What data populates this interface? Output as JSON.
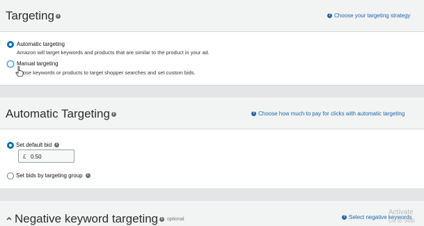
{
  "targeting": {
    "title": "Targeting",
    "strategy_link": "Choose your targeting strategy",
    "automatic_label": "Automatic targeting",
    "automatic_desc": "Amazon will target keywords and products that are similar to the product in your ad.",
    "manual_label": "Manual targeting",
    "manual_desc": "ose keywords or products to target shopper searches and set custom bids."
  },
  "auto_targeting": {
    "title": "Automatic Targeting",
    "pay_link": "Choose how much to pay for clicks with automatic targeting",
    "default_bid_label": "Set default bid",
    "currency": "£",
    "bid_value": "0.50",
    "group_bid_label": "Set bids by targeting group"
  },
  "negative": {
    "title": "Negative keyword targeting",
    "optional": "optional",
    "select_link": "Select negative keywords"
  },
  "watermark": {
    "line1": "Activate",
    "line2": "Go to Setti"
  },
  "icons": {
    "info": "info-icon",
    "help": "help-circle-icon",
    "collapse": "chevron-up-icon",
    "pointer": "hand-pointer-icon"
  },
  "colors": {
    "accent": "#0a71b8",
    "link": "#1b67a8"
  }
}
